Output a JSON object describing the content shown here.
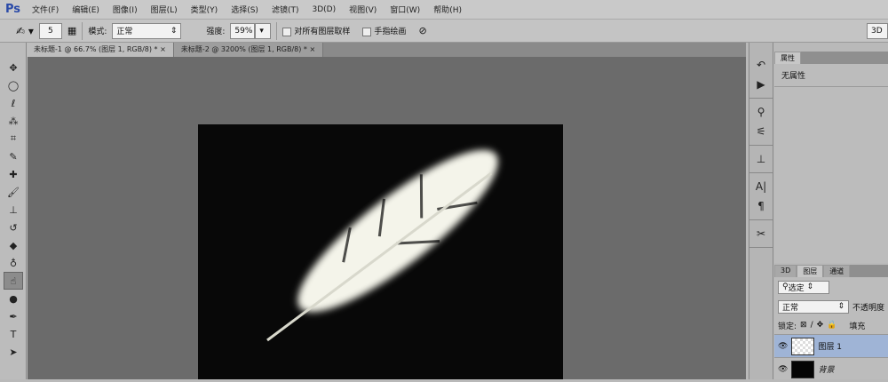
{
  "app": {
    "logo": "Ps"
  },
  "menu": [
    "文件(F)",
    "编辑(E)",
    "图像(I)",
    "图层(L)",
    "类型(Y)",
    "选择(S)",
    "滤镜(T)",
    "3D(D)",
    "视图(V)",
    "窗口(W)",
    "帮助(H)"
  ],
  "options": {
    "brush_size": "5",
    "mode_label": "模式:",
    "mode_value": "正常",
    "strength_label": "强度:",
    "strength_value": "59%",
    "sample_all_label": "对所有图层取样",
    "finger_paint_label": "手指绘画",
    "workspace": "3D"
  },
  "tabs": [
    {
      "label": "未标题-1 @ 66.7% (图层 1, RGB/8) *",
      "close": "×"
    },
    {
      "label": "未标题-2 @ 3200% (图层 1, RGB/8) *",
      "close": "×"
    }
  ],
  "properties": {
    "tab": "属性",
    "content": "无属性"
  },
  "layers_panel": {
    "tabs": [
      "3D",
      "图层",
      "通道"
    ],
    "filter": "选定",
    "blend_mode": "正常",
    "opacity_label": "不透明度",
    "lock_label": "锁定:",
    "fill_label": "填充",
    "layers": [
      {
        "name": "图层 1",
        "selected": true
      },
      {
        "name": "背景",
        "selected": false
      }
    ]
  },
  "colors": {
    "canvas_bg": "#6b6b6b",
    "document": "#080808",
    "selected_layer": "#9fb4d6"
  }
}
